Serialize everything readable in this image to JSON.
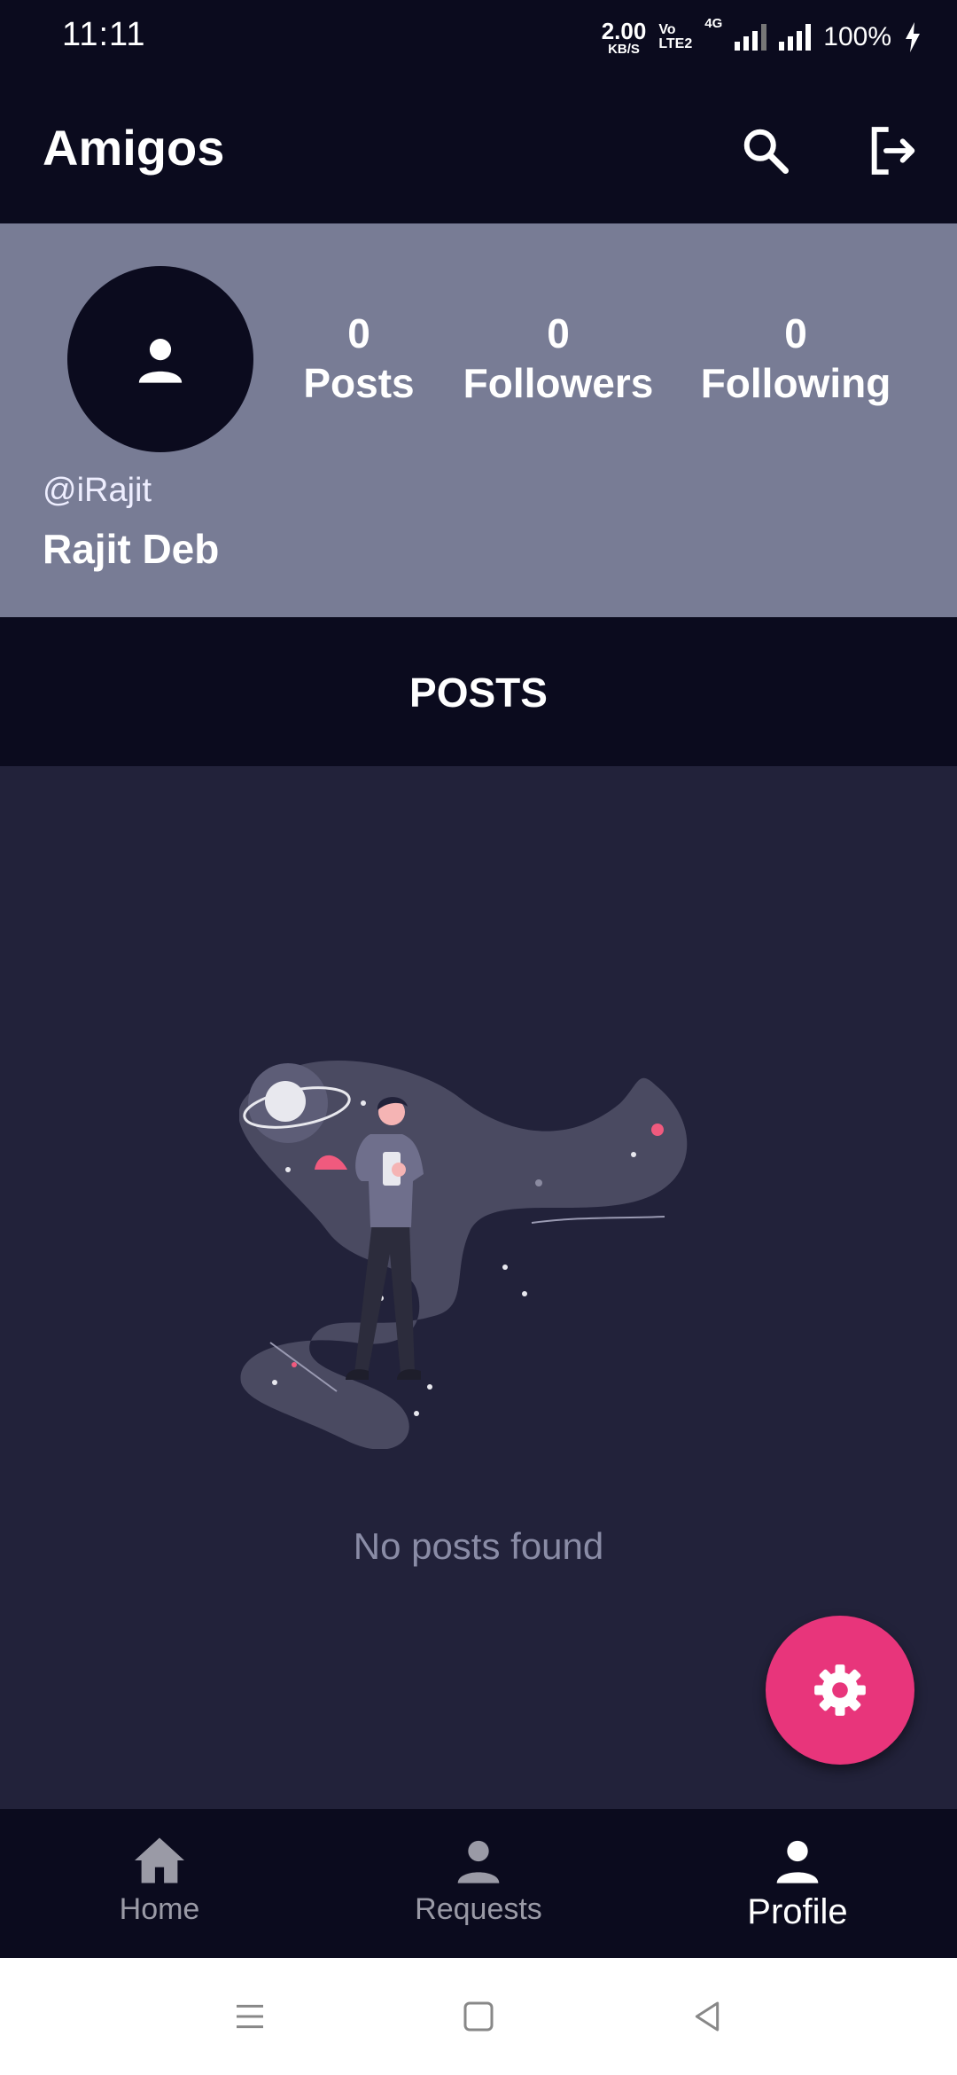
{
  "status_bar": {
    "time": "11:11",
    "net_speed_value": "2.00",
    "net_speed_unit": "KB/S",
    "volte_top": "Vo",
    "volte_bottom": "LTE2",
    "network_type": "4G",
    "battery": "100%"
  },
  "app_bar": {
    "title": "Amigos",
    "icons": [
      "search-icon",
      "logout-icon"
    ]
  },
  "profile": {
    "username": "@iRajit",
    "display_name": "Rajit Deb",
    "stats": [
      {
        "value": "0",
        "label": "Posts"
      },
      {
        "value": "0",
        "label": "Followers"
      },
      {
        "value": "0",
        "label": "Following"
      }
    ]
  },
  "tabs": [
    {
      "label": "POSTS",
      "active": true
    }
  ],
  "posts": {
    "empty_message": "No posts found"
  },
  "fab": {
    "icon": "gear-icon"
  },
  "bottom_nav": {
    "items": [
      {
        "label": "Home",
        "icon": "home-icon",
        "active": false
      },
      {
        "label": "Requests",
        "icon": "person-icon",
        "active": false
      },
      {
        "label": "Profile",
        "icon": "person-icon",
        "active": true
      }
    ]
  },
  "colors": {
    "appbar": "#0b0b1e",
    "profile_bg": "#787c95",
    "content_bg": "#22223a",
    "accent": "#e8357b",
    "muted_text": "#8a8ca6"
  }
}
